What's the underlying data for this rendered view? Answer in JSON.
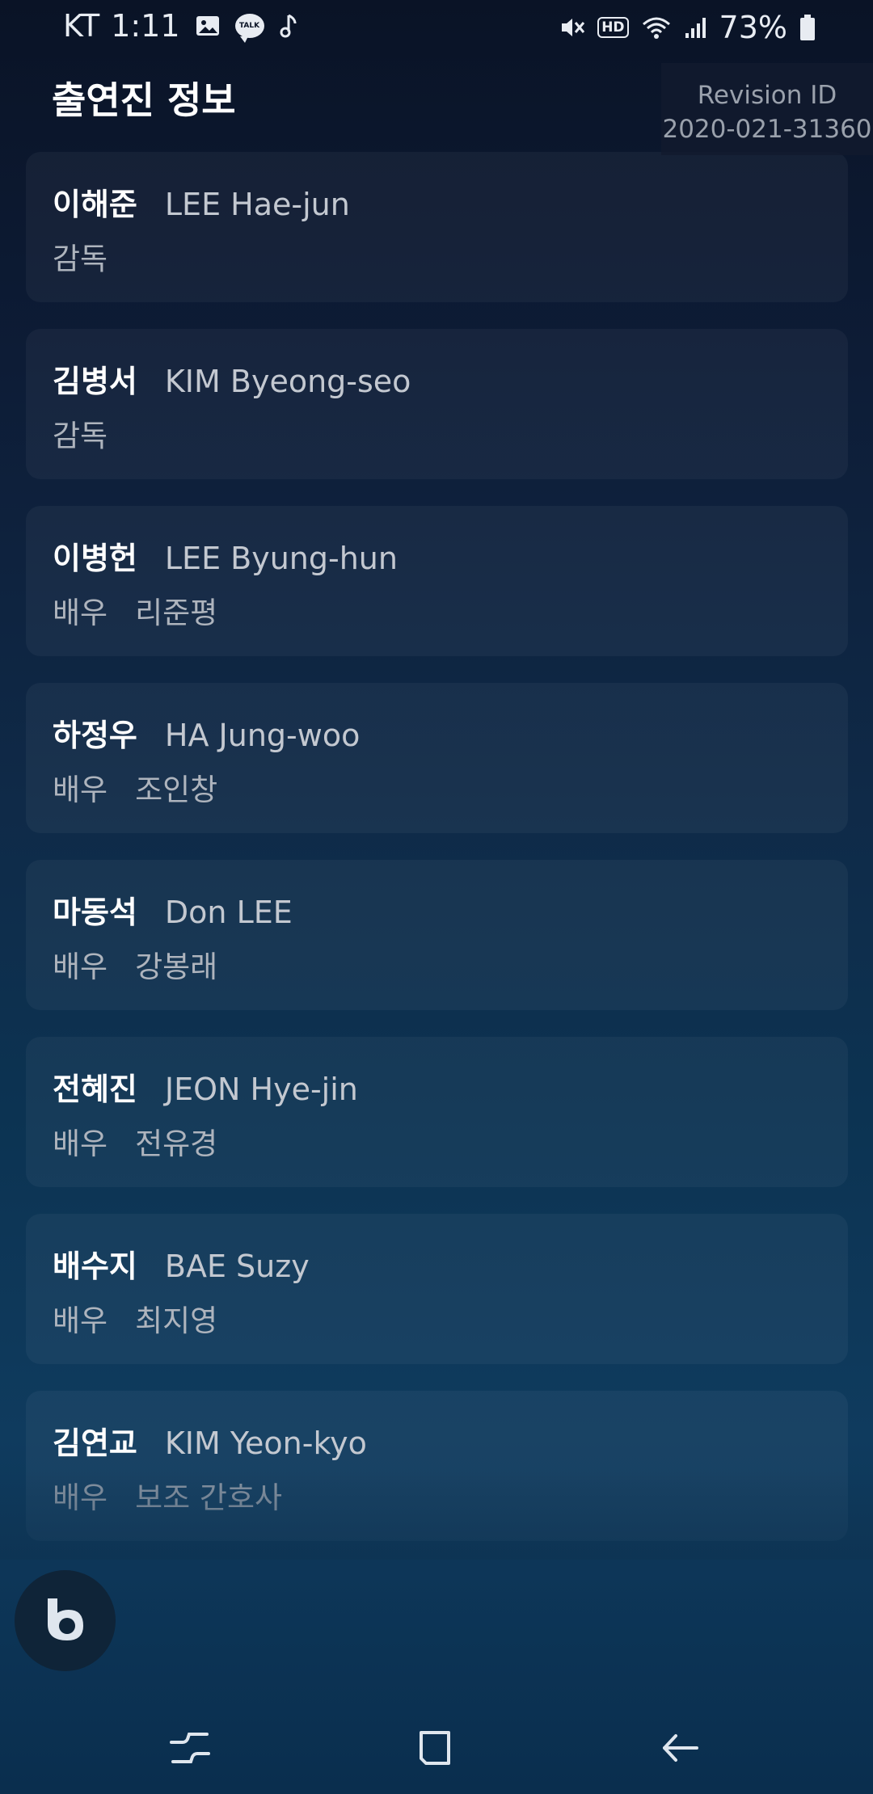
{
  "status_bar": {
    "carrier": "KT",
    "time": "1:11",
    "talk_badge": "TALK",
    "hd_badge": "HD",
    "battery": "73%",
    "icons": [
      "image-icon",
      "kakaotalk-icon",
      "music-note-icon",
      "mute-icon",
      "hd-icon",
      "wifi-icon",
      "signal-icon",
      "battery-icon"
    ]
  },
  "header": {
    "title": "출연진 정보"
  },
  "revision": {
    "label": "Revision ID",
    "value": "2020-021-31360"
  },
  "cast": [
    {
      "name": "이해준",
      "name_en": "LEE Hae-jun",
      "role": "감독",
      "character": ""
    },
    {
      "name": "김병서",
      "name_en": "KIM Byeong-seo",
      "role": "감독",
      "character": ""
    },
    {
      "name": "이병헌",
      "name_en": "LEE Byung-hun",
      "role": "배우",
      "character": "리준평"
    },
    {
      "name": "하정우",
      "name_en": "HA Jung-woo",
      "role": "배우",
      "character": "조인창"
    },
    {
      "name": "마동석",
      "name_en": "Don LEE",
      "role": "배우",
      "character": "강봉래"
    },
    {
      "name": "전혜진",
      "name_en": "JEON Hye-jin",
      "role": "배우",
      "character": "전유경"
    },
    {
      "name": "배수지",
      "name_en": "BAE Suzy",
      "role": "배우",
      "character": "최지영"
    },
    {
      "name": "김연교",
      "name_en": "KIM Yeon-kyo",
      "role": "배우",
      "character": "보조 간호사"
    }
  ],
  "bixby": {
    "icon": "bixby-icon"
  },
  "nav_bar": {
    "icons": [
      "recent-apps-icon",
      "home-icon",
      "back-icon"
    ]
  },
  "colors": {
    "background_top": "#0a1326",
    "background_bottom": "#0f3b5e",
    "card": "#ffffff0b",
    "primary_text": "#ffffff",
    "secondary_text": "#aeb4bd"
  }
}
